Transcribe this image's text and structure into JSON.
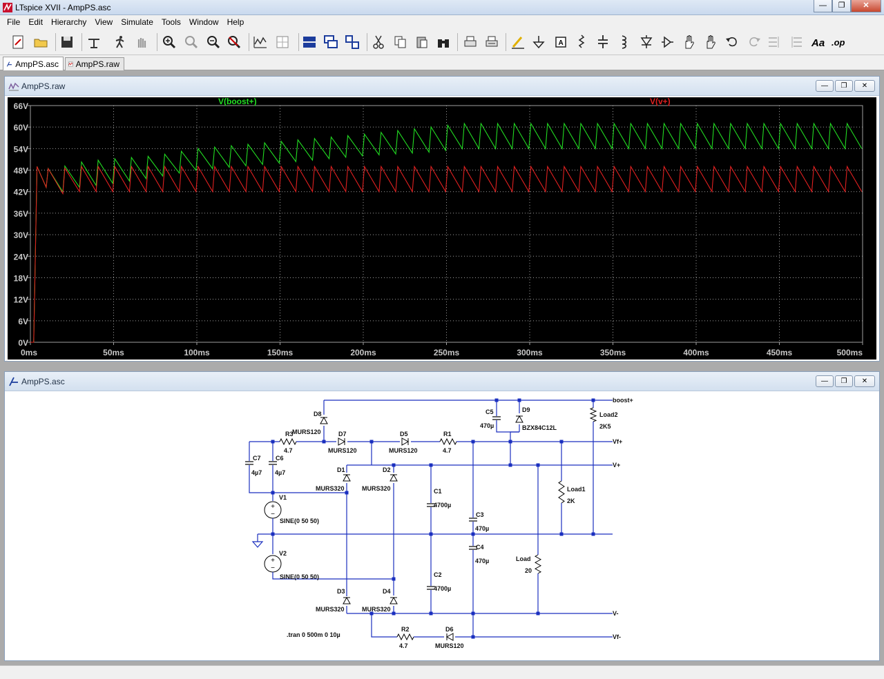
{
  "window": {
    "title": "LTspice XVII - AmpPS.asc"
  },
  "menu": [
    "File",
    "Edit",
    "Hierarchy",
    "View",
    "Simulate",
    "Tools",
    "Window",
    "Help"
  ],
  "toolbar": [
    "new-schematic-icon",
    "open-folder-icon",
    "save-icon",
    "control-panel-icon",
    "run-icon",
    "halt-icon",
    "zoom-in-icon",
    "zoom-pan-icon",
    "zoom-out-icon",
    "zoom-cancel-icon",
    "autorange-icon",
    "scale-icon",
    "tile-horizontal-icon",
    "cascade-icon",
    "tile-vertical-icon",
    "cut-icon",
    "copy-icon",
    "paste-icon",
    "find-icon",
    "print-icon",
    "print-setup-icon",
    "draw-wire-icon",
    "ground-icon",
    "label-net-icon",
    "resistor-icon",
    "capacitor-icon",
    "inductor-icon",
    "diode-icon",
    "component-icon",
    "move-icon",
    "drag-icon",
    "undo-icon",
    "redo-icon",
    "rotate-icon",
    "mirror-icon",
    "text-icon",
    "spice-directive-icon"
  ],
  "tabs": [
    {
      "label": "AmpPS.asc",
      "active": true
    },
    {
      "label": "AmpPS.raw",
      "active": false
    }
  ],
  "plot_window": {
    "title": "AmpPS.raw"
  },
  "schematic_window": {
    "title": "AmpPS.asc"
  },
  "colors": {
    "trace_boost": "#22dd22",
    "trace_v": "#e02020",
    "grid": "#a0a0a0"
  },
  "chart_data": {
    "type": "line",
    "title": "",
    "xlabel": "",
    "ylabel": "",
    "x_ticks": [
      "0ms",
      "50ms",
      "100ms",
      "150ms",
      "200ms",
      "250ms",
      "300ms",
      "350ms",
      "400ms",
      "450ms",
      "500ms"
    ],
    "y_ticks": [
      "0V",
      "6V",
      "12V",
      "18V",
      "24V",
      "30V",
      "36V",
      "42V",
      "48V",
      "54V",
      "60V",
      "66V"
    ],
    "xlim": [
      0,
      500
    ],
    "ylim": [
      0,
      66
    ],
    "x_unit": "ms",
    "y_unit": "V",
    "period_ms": 10,
    "series": [
      {
        "name": "V(boost+)",
        "color": "#22dd22",
        "peaks": [
          [
            5,
            49
          ],
          [
            15,
            48
          ],
          [
            25,
            50
          ],
          [
            45,
            51
          ],
          [
            75,
            52
          ],
          [
            100,
            54
          ],
          [
            150,
            56
          ],
          [
            200,
            58
          ],
          [
            240,
            60
          ],
          [
            260,
            61
          ],
          [
            300,
            61
          ],
          [
            500,
            61
          ]
        ],
        "troughs": [
          [
            5,
            45
          ],
          [
            15,
            41
          ],
          [
            25,
            43
          ],
          [
            45,
            44
          ],
          [
            75,
            46
          ],
          [
            100,
            48
          ],
          [
            150,
            50
          ],
          [
            200,
            52
          ],
          [
            240,
            53
          ],
          [
            260,
            54
          ],
          [
            300,
            54
          ],
          [
            500,
            54
          ]
        ]
      },
      {
        "name": "V(v+)",
        "color": "#e02020",
        "peaks": [
          [
            5,
            49
          ],
          [
            15,
            48
          ],
          [
            25,
            49
          ],
          [
            500,
            49
          ]
        ],
        "troughs": [
          [
            5,
            45
          ],
          [
            15,
            41
          ],
          [
            25,
            42
          ],
          [
            500,
            42
          ]
        ]
      }
    ]
  },
  "schematic": {
    "components": [
      {
        "ref": "D8",
        "value": "MURS120"
      },
      {
        "ref": "D7",
        "value": "MURS120"
      },
      {
        "ref": "D5",
        "value": "MURS120"
      },
      {
        "ref": "R1",
        "value": "4.7"
      },
      {
        "ref": "R3",
        "value": "4.7"
      },
      {
        "ref": "C5",
        "value": "470µ"
      },
      {
        "ref": "D9",
        "value": "BZX84C12L"
      },
      {
        "ref": "Load2",
        "value": "2K5"
      },
      {
        "ref": "C7",
        "value": "4µ7"
      },
      {
        "ref": "C6",
        "value": "4µ7"
      },
      {
        "ref": "D1",
        "value": "MURS320"
      },
      {
        "ref": "D2",
        "value": "MURS320"
      },
      {
        "ref": "C1",
        "value": "4700µ"
      },
      {
        "ref": "C3",
        "value": "470µ"
      },
      {
        "ref": "Load1",
        "value": "2K"
      },
      {
        "ref": "V1",
        "value": "SINE(0 50 50)"
      },
      {
        "ref": "V2",
        "value": "SINE(0 50 50)"
      },
      {
        "ref": "C4",
        "value": "470µ"
      },
      {
        "ref": "Load",
        "value": "20"
      },
      {
        "ref": "C2",
        "value": "4700µ"
      },
      {
        "ref": "D3",
        "value": "MURS320"
      },
      {
        "ref": "D4",
        "value": "MURS320"
      },
      {
        "ref": "R2",
        "value": "4.7"
      },
      {
        "ref": "D6",
        "value": "MURS120"
      }
    ],
    "nets": [
      "boost+",
      "Vf+",
      "V+",
      "V-",
      "Vf-"
    ],
    "directive": ".tran 0 500m 0 10µ"
  }
}
